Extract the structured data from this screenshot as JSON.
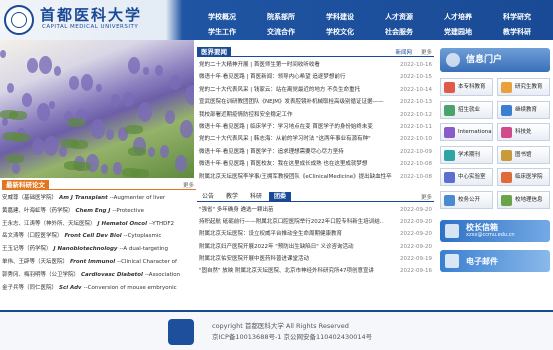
{
  "header": {
    "title": "首都医科大学",
    "subtitle": "CAPITAL MEDICAL UNIVERSITY",
    "nav": [
      [
        "学校概况",
        "院系部所",
        "学科建设",
        "人才资源",
        "人才培养",
        "科学研究"
      ],
      [
        "学生工作",
        "交流合作",
        "学校文化",
        "社会服务",
        "党建园地",
        "教学科研"
      ]
    ]
  },
  "news": {
    "title": "医界要闻",
    "tab": "新闻网",
    "more": "更多",
    "items": [
      {
        "t": "党的二十大精神开展 | 首医师生第一时间收听收看",
        "d": "2022-10-16"
      },
      {
        "t": "微语十年·看见医路 | 首医新闻：领导内心希望 追逐梦想前行",
        "d": "2022-10-15"
      },
      {
        "t": "党的二十大代表风采 | 钱家云：站在离党最近的地方 不负生命重托",
        "d": "2022-10-14"
      },
      {
        "t": "宣武医院在训研教团团队《NEJM》发表腔镜补机械取栓高级别循证证据——",
        "d": "2022-10-13"
      },
      {
        "t": "我校部署近期疫情防控和安全稳定工作",
        "d": "2022-10-12"
      },
      {
        "t": "微语十年·看见医路 | 临床学子：学习地点在变 首医学子的身份始终未变",
        "d": "2022-10-11"
      },
      {
        "t": "党的二十大代表风采 | 韩志海：从前的学习时法 \"这两年事业有源有种\"",
        "d": "2022-10-10"
      },
      {
        "t": "微语十年·看见医路 | 首医学子：追求理想需要尽心尽力坚持",
        "d": "2022-10-09"
      },
      {
        "t": "微语十年·看见医路 | 首医校友：我在这里成长成熟 也在这里成就梦想",
        "d": "2022-10-08"
      },
      {
        "t": "附属北京天坛医院李学事/王拥军教授团队《eClinicalMedicine》提出缺血性卒",
        "d": "2022-10-08"
      }
    ]
  },
  "notice": {
    "tabs": [
      "公告",
      "教学",
      "科研",
      "团委"
    ],
    "active_tab": "团委",
    "more": "更多",
    "items": [
      {
        "t": "\"强省\" 多年确身 遴选一颗出苗",
        "d": "2022-09-20"
      },
      {
        "t": "持积起航 砥砺前行——附属北京口腔医院举行2022年口腔专科新生培训结..",
        "d": "2022-09-20"
      },
      {
        "t": "附属北京天坛医院：设立权威平台推动全生命周期健康教育",
        "d": "2022-09-20"
      },
      {
        "t": "附属北京妇产医院开展2022年 \"预防出生缺陷日\" 义诊咨询活动",
        "d": "2022-09-20"
      },
      {
        "t": "附属北京佑安医院开展中医药科普进课堂活动",
        "d": "2022-09-19"
      },
      {
        "t": "\"固自然\" 放映 附属北京天坛医院、北京市神经外科研究所47项创意宣讲",
        "d": "2022-09-16"
      }
    ]
  },
  "research": {
    "title": "最新科研论文",
    "more": "更多",
    "items": [
      {
        "a": "安威尊（基础医学院）",
        "j": "Am J Transplant",
        "r": "--Augmenter of liver"
      },
      {
        "a": "黄嘉建、叶海虹等（药学院）",
        "j": "Chem Eng J",
        "r": "--Protective"
      },
      {
        "a": "王永志、江涛等（神外所、天坛医院）",
        "j": "J Hematol Oncol",
        "r": "--YTHDF2"
      },
      {
        "a": "岳文涛等（口腔医学院）",
        "j": "Front Cell Dev Biol",
        "r": "--Cytoplasmic"
      },
      {
        "a": "王玉记等（药学院）",
        "j": "J Nanobiotechnology",
        "r": "--A dual-targeting"
      },
      {
        "a": "单伟、王辟等（天坛医院）",
        "j": "Front Immunol",
        "r": "--Clinical Character of"
      },
      {
        "a": "郭秀冈、梅羽明等（公卫学院）",
        "j": "Cardiovasc Diabetol",
        "r": "--Association"
      },
      {
        "a": "金子兵等（同仁医院）",
        "j": "Sci Adv",
        "r": "--Conversion of mouse embryonic"
      }
    ]
  },
  "portal": {
    "title": "信息门户",
    "items": [
      "本专科教育",
      "研究生教育",
      "招生就业",
      "继续教育",
      "International Education",
      "科技处",
      "学术期刊",
      "图书馆",
      "中心实验室",
      "临床医学院",
      "校务公开",
      "校地理信息"
    ]
  },
  "banners": [
    {
      "label": "校长信箱",
      "sub": "xzxx@ccmu.edu.cn"
    },
    {
      "label": "电子邮件"
    }
  ],
  "footer": {
    "copyright": "copyright 首都医科大学 All Rights Reserved",
    "icp": "京ICP备10013688号-1 京公网安备110402430014号"
  },
  "colors": {
    "primary": "#1a4a95",
    "accent": "#e4751c",
    "tab_active": "#1a4a95"
  }
}
